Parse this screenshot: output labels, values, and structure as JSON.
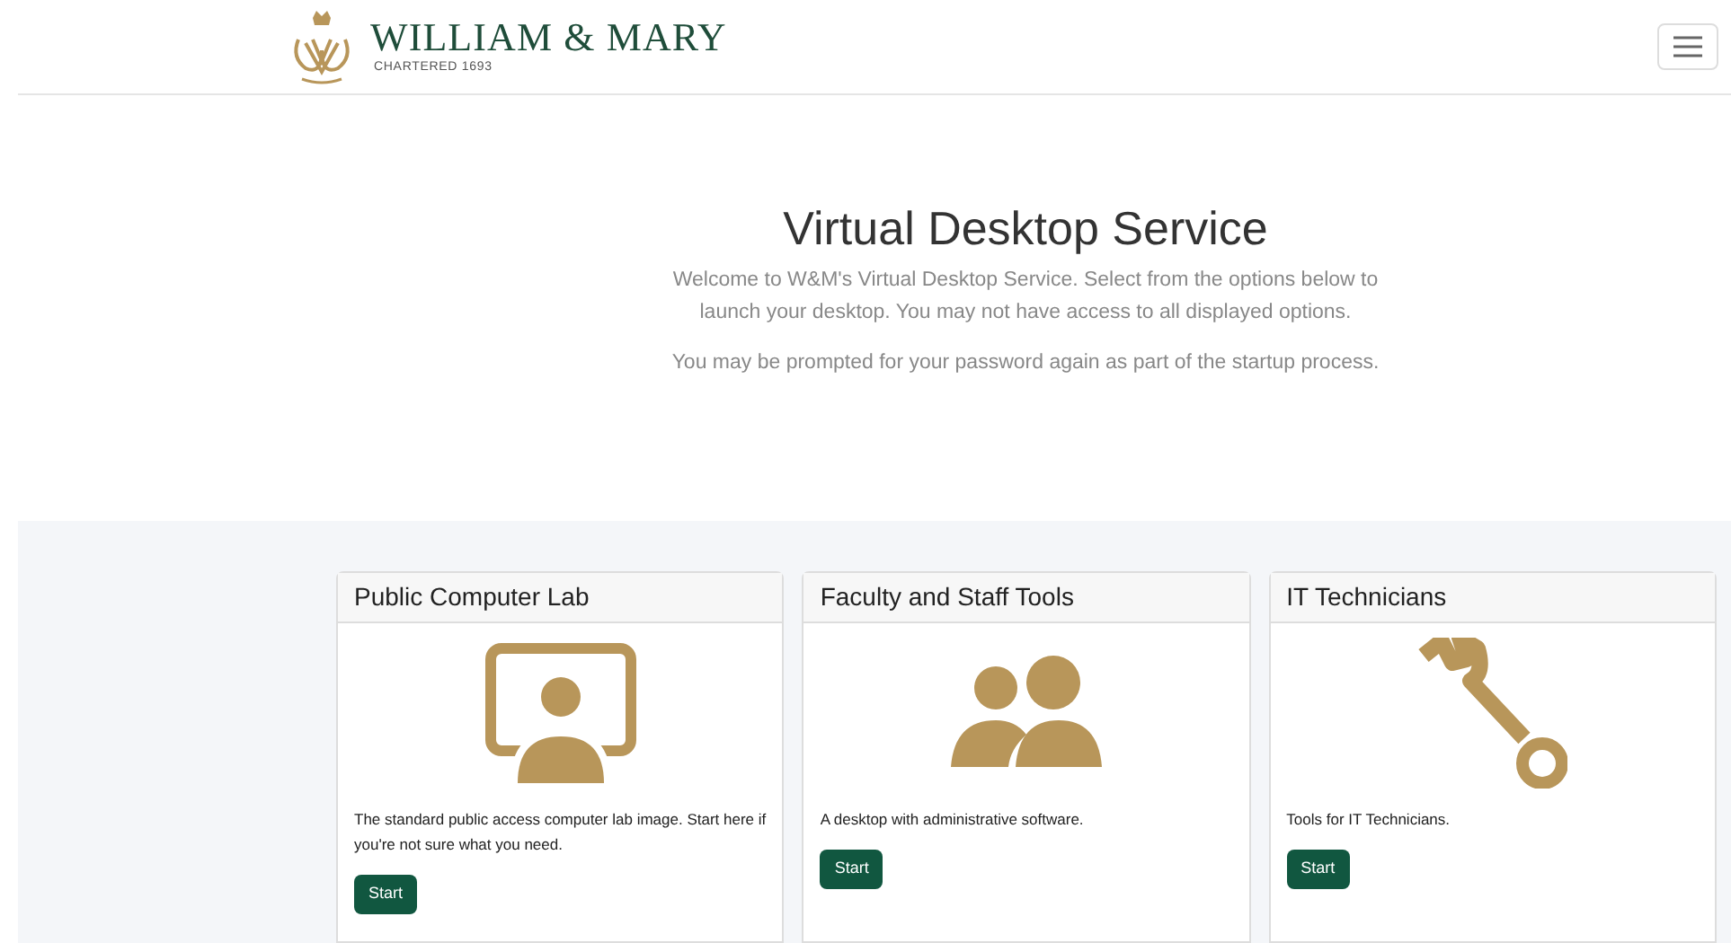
{
  "header": {
    "brand": "WILLIAM & MARY",
    "tagline": "CHARTERED 1693"
  },
  "hero": {
    "title": "Virtual Desktop Service",
    "intro": "Welcome to W&M's Virtual Desktop Service. Select from the options below to launch your desktop. You may not have access to all displayed options.",
    "note": "You may be prompted for your password again as part of the startup process."
  },
  "cards": [
    {
      "title": "Public Computer Lab",
      "kind": "lab",
      "description": "The standard public access computer lab image. Start here if you're not sure what you need.",
      "button": "Start"
    },
    {
      "title": "Faculty and Staff Tools",
      "kind": "staff",
      "description": "A desktop with administrative software.",
      "button": "Start"
    },
    {
      "title": "IT Technicians",
      "kind": "tech",
      "description": "Tools for IT Technicians.",
      "button": "Start"
    }
  ]
}
